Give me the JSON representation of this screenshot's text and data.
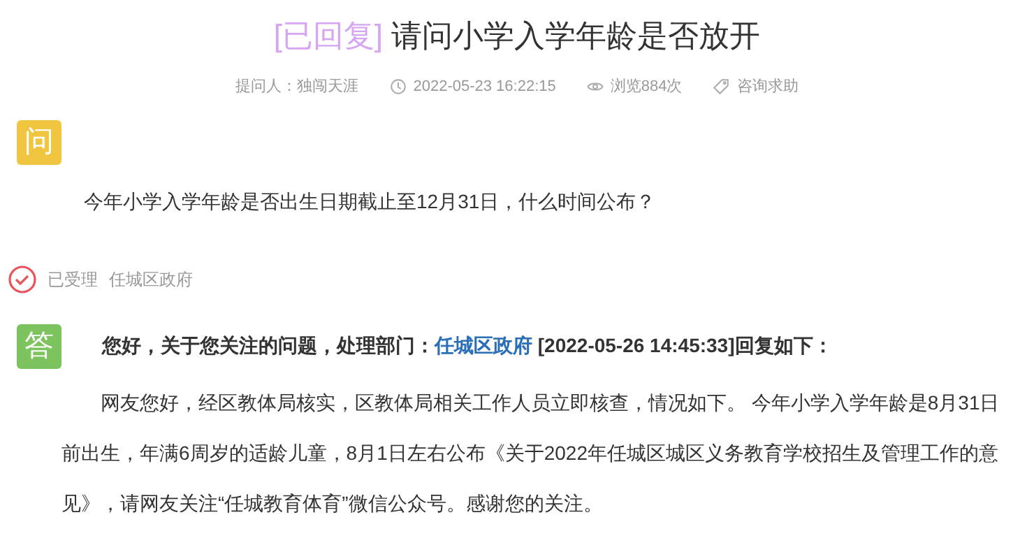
{
  "title": {
    "status": "[已回复]",
    "text": "请问小学入学年龄是否放开"
  },
  "meta": [
    {
      "kind": "person",
      "text": "提问人：独闯天涯"
    },
    {
      "kind": "time",
      "text": "2022-05-23 16:22:15"
    },
    {
      "kind": "views",
      "text": "浏览884次"
    },
    {
      "kind": "tag",
      "text": "咨询求助"
    }
  ],
  "question": {
    "badge": "问",
    "text": "今年小学入学年龄是否出生日期截止至12月31日，什么时间公布？"
  },
  "status": {
    "state": "已受理",
    "department": "任城区政府"
  },
  "answer": {
    "badge": "答",
    "intro": "您好，关于您关注的问题，处理部门：",
    "department": "任城区政府",
    "reply_time": " [2022-05-26 14:45:33]回复如下：",
    "text": "网友您好，经区教体局核实，区教体局相关工作人员立即核查，情况如下。 今年小学入学年龄是8月31日前出生，年满6周岁的适龄儿童，8月1日左右公布《关于2022年任城区城区义务教育学校招生及管理工作的意见》，请网友关注“任城教育体育”微信公众号。感谢您的关注。"
  }
}
